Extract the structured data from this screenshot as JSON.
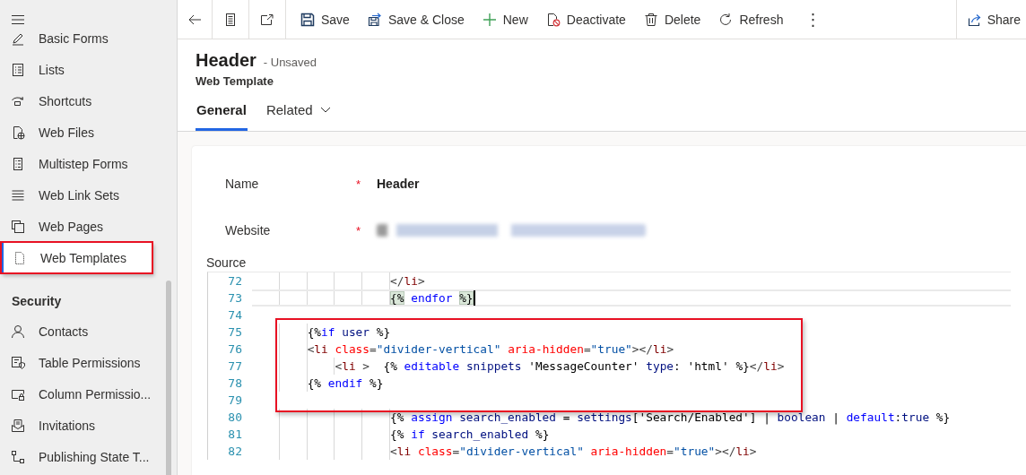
{
  "sidebar": {
    "sections": [
      {
        "items": [
          {
            "label": "Basic Forms",
            "kind": "form",
            "selected": false,
            "boxed": false
          },
          {
            "label": "Lists",
            "kind": "list",
            "selected": false,
            "boxed": false
          },
          {
            "label": "Shortcuts",
            "kind": "shortcut",
            "selected": false,
            "boxed": false
          },
          {
            "label": "Web Files",
            "kind": "webfile",
            "selected": false,
            "boxed": false
          },
          {
            "label": "Multistep Forms",
            "kind": "multistep",
            "selected": false,
            "boxed": false
          },
          {
            "label": "Web Link Sets",
            "kind": "lines",
            "selected": false,
            "boxed": false
          },
          {
            "label": "Web Pages",
            "kind": "pages",
            "selected": false,
            "boxed": false
          },
          {
            "label": "Web Templates",
            "kind": "template",
            "selected": true,
            "boxed": true
          }
        ]
      },
      {
        "title": "Security",
        "items": [
          {
            "label": "Contacts",
            "kind": "person",
            "selected": false,
            "boxed": false
          },
          {
            "label": "Table Permissions",
            "kind": "tableperm",
            "selected": false,
            "boxed": false
          },
          {
            "label": "Column Permissio...",
            "kind": "columnperm",
            "selected": false,
            "boxed": false
          },
          {
            "label": "Invitations",
            "kind": "invite",
            "selected": false,
            "boxed": false
          },
          {
            "label": "Publishing State T...",
            "kind": "flow",
            "selected": false,
            "boxed": false
          }
        ]
      }
    ]
  },
  "command_bar": {
    "items": [
      {
        "kind": "back"
      },
      {
        "kind": "record"
      },
      {
        "kind": "popout"
      },
      {
        "kind": "save",
        "label": "Save"
      },
      {
        "kind": "saveclose",
        "label": "Save & Close"
      },
      {
        "kind": "new",
        "label": "New"
      },
      {
        "kind": "deactivate",
        "label": "Deactivate"
      },
      {
        "kind": "delete",
        "label": "Delete"
      },
      {
        "kind": "refresh",
        "label": "Refresh"
      },
      {
        "kind": "more",
        "label": "⋮"
      },
      {
        "kind": "share",
        "label": "Share"
      }
    ]
  },
  "record": {
    "title": "Header",
    "status": "- Unsaved",
    "entity": "Web Template"
  },
  "tabs": [
    {
      "label": "General",
      "selected": true,
      "dropdown": false
    },
    {
      "label": "Related",
      "selected": false,
      "dropdown": true
    }
  ],
  "form": {
    "fields": [
      {
        "label": "Name",
        "required_mark": "*",
        "value": "Header",
        "redacted": false
      },
      {
        "label": "Website",
        "required_mark": "*",
        "redacted": true
      }
    ],
    "source": {
      "label": "Source",
      "lines": [
        {
          "number": "72",
          "tokens": [
            {
              "kind": "punct",
              "text": "                    </"
            },
            {
              "kind": "tag",
              "text": "li"
            },
            {
              "kind": "punct",
              "text": ">"
            }
          ],
          "current": false,
          "cursor": false,
          "boxed": false
        },
        {
          "number": "73",
          "tokens": [
            {
              "kind": "match",
              "text": "                    {%"
            },
            {
              "kind": "kw",
              "text": " endfor "
            },
            {
              "kind": "match",
              "text": "%}"
            }
          ],
          "current": true,
          "cursor": true,
          "boxed": false
        },
        {
          "number": "74",
          "current": false,
          "cursor": false,
          "boxed": false
        },
        {
          "number": "75",
          "tokens": [
            {
              "kind": "text",
              "text": "        {%"
            },
            {
              "kind": "kw",
              "text": "if"
            },
            {
              "kind": "var",
              "text": " user"
            },
            {
              "kind": "text",
              "text": " %}"
            }
          ],
          "current": false,
          "cursor": false,
          "boxed": true
        },
        {
          "number": "76",
          "tokens": [
            {
              "kind": "punct",
              "text": "        <"
            },
            {
              "kind": "tag",
              "text": "li"
            },
            {
              "kind": "attr",
              "text": " class"
            },
            {
              "kind": "punct",
              "text": "="
            },
            {
              "kind": "str",
              "text": "\"divider-vertical\""
            },
            {
              "kind": "attr",
              "text": " aria-hidden"
            },
            {
              "kind": "punct",
              "text": "="
            },
            {
              "kind": "str",
              "text": "\"true\""
            },
            {
              "kind": "punct",
              "text": "></"
            },
            {
              "kind": "tag",
              "text": "li"
            },
            {
              "kind": "punct",
              "text": ">"
            }
          ],
          "current": false,
          "cursor": false,
          "boxed": true
        },
        {
          "number": "77",
          "tokens": [
            {
              "kind": "punct",
              "text": "            <"
            },
            {
              "kind": "tag",
              "text": "li"
            },
            {
              "kind": "punct",
              "text": " >  "
            },
            {
              "kind": "text",
              "text": "{% "
            },
            {
              "kind": "kw",
              "text": "editable"
            },
            {
              "kind": "var",
              "text": " snippets"
            },
            {
              "kind": "text",
              "text": " 'MessageCounter' "
            },
            {
              "kind": "var",
              "text": "type"
            },
            {
              "kind": "text",
              "text": ": 'html' %}"
            },
            {
              "kind": "punct",
              "text": "</"
            },
            {
              "kind": "tag",
              "text": "li"
            },
            {
              "kind": "punct",
              "text": ">"
            }
          ],
          "current": false,
          "cursor": false,
          "boxed": true
        },
        {
          "number": "78",
          "tokens": [
            {
              "kind": "text",
              "text": "        {% "
            },
            {
              "kind": "kw",
              "text": "endif"
            },
            {
              "kind": "text",
              "text": " %}"
            }
          ],
          "current": false,
          "cursor": false,
          "boxed": true
        },
        {
          "number": "79",
          "current": false,
          "cursor": false,
          "boxed": true
        },
        {
          "number": "80",
          "tokens": [
            {
              "kind": "text",
              "text": "                    {% "
            },
            {
              "kind": "kw",
              "text": "assign"
            },
            {
              "kind": "var",
              "text": " search_enabled"
            },
            {
              "kind": "text",
              "text": " = "
            },
            {
              "kind": "var",
              "text": "settings"
            },
            {
              "kind": "text",
              "text": "['Search/Enabled'] | "
            },
            {
              "kind": "var",
              "text": "boolean"
            },
            {
              "kind": "text",
              "text": " | "
            },
            {
              "kind": "kw",
              "text": "default"
            },
            {
              "kind": "text",
              "text": ":"
            },
            {
              "kind": "var",
              "text": "true"
            },
            {
              "kind": "text",
              "text": " %}"
            }
          ],
          "current": false,
          "cursor": false,
          "boxed": false
        },
        {
          "number": "81",
          "tokens": [
            {
              "kind": "text",
              "text": "                    {% "
            },
            {
              "kind": "kw",
              "text": "if"
            },
            {
              "kind": "var",
              "text": " search_enabled"
            },
            {
              "kind": "text",
              "text": " %}"
            }
          ],
          "current": false,
          "cursor": false,
          "boxed": false
        },
        {
          "number": "82",
          "tokens": [
            {
              "kind": "punct",
              "text": "                    <"
            },
            {
              "kind": "tag",
              "text": "li"
            },
            {
              "kind": "attr",
              "text": " class"
            },
            {
              "kind": "punct",
              "text": "="
            },
            {
              "kind": "str",
              "text": "\"divider-vertical\""
            },
            {
              "kind": "attr",
              "text": " aria-hidden"
            },
            {
              "kind": "punct",
              "text": "="
            },
            {
              "kind": "str",
              "text": "\"true\""
            },
            {
              "kind": "punct",
              "text": "></"
            },
            {
              "kind": "tag",
              "text": "li"
            },
            {
              "kind": "punct",
              "text": ">"
            }
          ],
          "current": false,
          "cursor": false,
          "boxed": false
        }
      ]
    }
  }
}
